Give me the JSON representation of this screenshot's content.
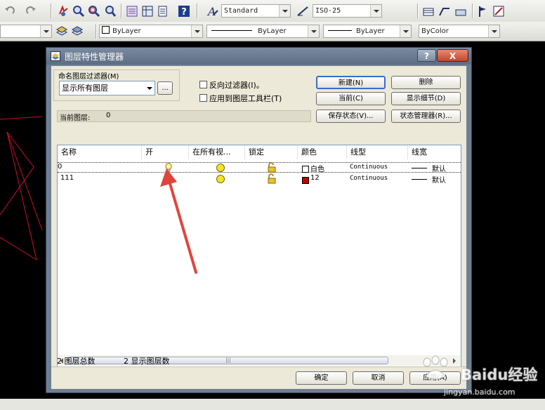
{
  "toolbar": {
    "text_style": "Standard",
    "dim_style": "ISO-25",
    "layer_combo": "ByLayer",
    "linetype_combo": "ByLayer",
    "lineweight_combo": "ByLayer",
    "color_combo": "ByColor"
  },
  "dialog": {
    "title": "图层特性管理器",
    "help_label": "?",
    "close_label": "X",
    "filter_group_label": "命名图层过滤器(M)",
    "filter_value": "显示所有图层",
    "browse_label": "...",
    "invert_filter_label": "反向过滤器(I)。",
    "apply_toolbar_label": "应用到图层工具栏(T)",
    "current_layer_label": "当前图层:",
    "current_layer_value": "0",
    "buttons": {
      "new": "新建(N)",
      "delete": "删除",
      "current": "当前(C)",
      "show_details": "显示细节(D)",
      "save_state": "保存状态(V)...",
      "state_manager": "状态管理器(R)..."
    },
    "columns": [
      "名称",
      "开",
      "在所有视...",
      "锁定",
      "颜色",
      "线型",
      "线宽"
    ],
    "layers": [
      {
        "name": "0",
        "color_label": "白色",
        "color_hex": "#ffffff",
        "linetype": "Continuous",
        "lineweight": "默认"
      },
      {
        "name": "111",
        "color_label": "12",
        "color_hex": "#c00000",
        "linetype": "Continuous",
        "lineweight": "默认"
      }
    ],
    "scroll_thumb": "|||",
    "status_total": "2 图层总数",
    "status_shown": "2 显示图层数",
    "ok": "确定",
    "cancel": "取消",
    "apply": "应用(A)"
  },
  "watermark": {
    "brand": "Baidu经验",
    "url": "jingyan.baidu.com"
  },
  "colors": {
    "annotation_arrow": "#e0453b",
    "canvas": "#000000",
    "drawing_lines": "#c8102e"
  }
}
